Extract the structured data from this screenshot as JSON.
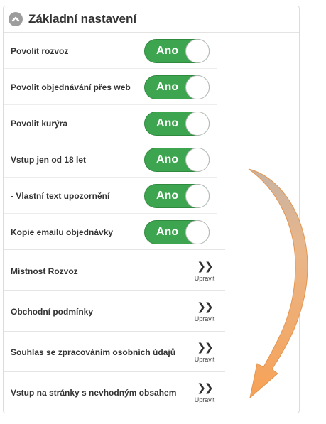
{
  "panel": {
    "title": "Základní nastavení",
    "toggle_rows": [
      {
        "label": "Povolit rozvoz",
        "value": "Ano"
      },
      {
        "label": "Povolit objednávání přes web",
        "value": "Ano"
      },
      {
        "label": "Povolit kurýra",
        "value": "Ano"
      },
      {
        "label": "Vstup jen od 18 let",
        "value": "Ano"
      },
      {
        "label": "- Vlastní text upozornění",
        "value": "Ano"
      },
      {
        "label": "Kopie emailu objednávky",
        "value": "Ano"
      }
    ],
    "link_rows": [
      {
        "label": "Místnost Rozvoz",
        "action": "Upravit"
      },
      {
        "label": "Obchodní podmínky",
        "action": "Upravit"
      },
      {
        "label": "Souhlas se zpracováním osobních údajů",
        "action": "Upravit"
      },
      {
        "label": "Vstup na stránky s nevhodným obsahem",
        "action": "Upravit"
      }
    ]
  },
  "colors": {
    "toggle_on": "#3da54f",
    "annotation_arrow": "#f3a055"
  },
  "icons": {
    "collapse": "chevron-up-icon",
    "edit": "double-chevron-right-icon"
  }
}
